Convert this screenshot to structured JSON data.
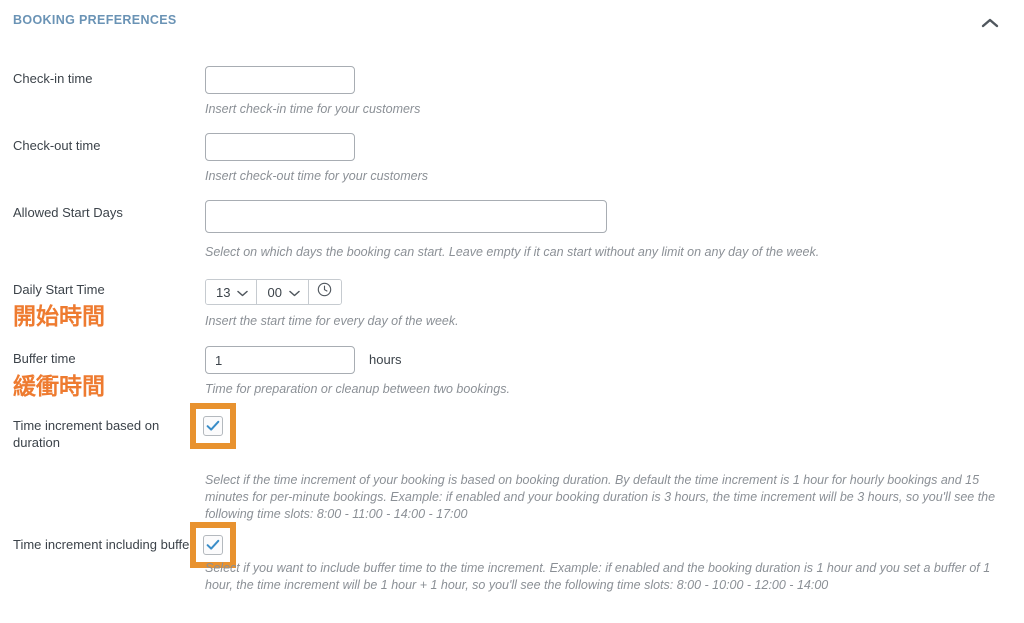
{
  "panel": {
    "title": "BOOKING PREFERENCES",
    "collapse_icon": "chevron-up-icon",
    "accent_blue": "#6a93b5",
    "highlight_orange": "#e8922f",
    "jp_text_orange": "#ee7b30",
    "check_blue": "#3a8dc8"
  },
  "fields": {
    "check_in": {
      "label": "Check-in time",
      "value": "",
      "placeholder": "",
      "helper": "Insert check-in time for your customers"
    },
    "check_out": {
      "label": "Check-out time",
      "value": "",
      "placeholder": "",
      "helper": "Insert check-out time for your customers"
    },
    "allowed_start_days": {
      "label": "Allowed Start Days",
      "value": "",
      "placeholder": "",
      "helper": "Select on which days the booking can start. Leave empty if it can start without any limit on any day of the week."
    },
    "daily_start_time": {
      "label": "Daily Start Time",
      "jp_label": "開始時間",
      "hour": "13",
      "minute": "00",
      "clock_icon": "clock-icon",
      "helper": "Insert the start time for every day of the week."
    },
    "buffer_time": {
      "label": "Buffer time",
      "jp_label": "緩衝時間",
      "value": "1",
      "unit": "hours",
      "helper": "Time for preparation or cleanup between two bookings."
    },
    "time_increment_duration": {
      "label": "Time increment based on duration",
      "checked": true,
      "helper": "Select if the time increment of your booking is based on booking duration. By default the time increment is 1 hour for hourly bookings and 15 minutes for per-minute bookings. Example: if enabled and your booking duration is 3 hours, the time increment will be 3 hours, so you'll see the following time slots: 8:00 - 11:00 - 14:00 - 17:00"
    },
    "time_increment_buffer": {
      "label": "Time increment including buffer",
      "checked": true,
      "helper": "Select if you want to include buffer time to the time increment. Example: if enabled and the booking duration is 1 hour and you set a buffer of 1 hour, the time increment will be 1 hour + 1 hour, so you'll see the following time slots: 8:00 - 10:00 - 12:00 - 14:00"
    }
  }
}
